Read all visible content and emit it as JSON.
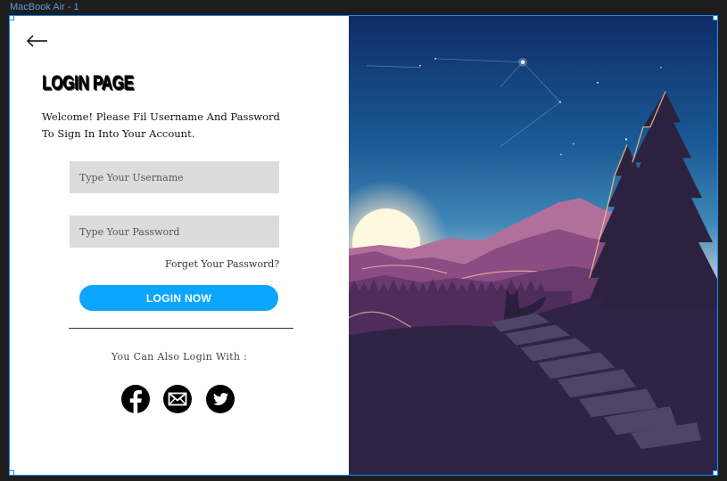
{
  "frame": {
    "label": "MacBook Air - 1"
  },
  "login": {
    "title": "LOGIN PAGE",
    "welcome_line1": "Welcome! Please Fil Username And Password",
    "welcome_line2": "To Sign In Into Your Account.",
    "username_placeholder": "Type Your Username",
    "password_placeholder": "Type Your Password",
    "forgot_label": "Forget Your Password?",
    "button_label": "LOGIN NOW",
    "also_label": "You Can Also Login With :"
  },
  "social": [
    {
      "icon": "facebook-icon"
    },
    {
      "icon": "mail-icon"
    },
    {
      "icon": "twitter-icon"
    }
  ],
  "colors": {
    "accent": "#0aa6ff",
    "input_bg": "#dcdcdc",
    "panel_bg": "#ffffff",
    "selection": "#1a8cff"
  }
}
